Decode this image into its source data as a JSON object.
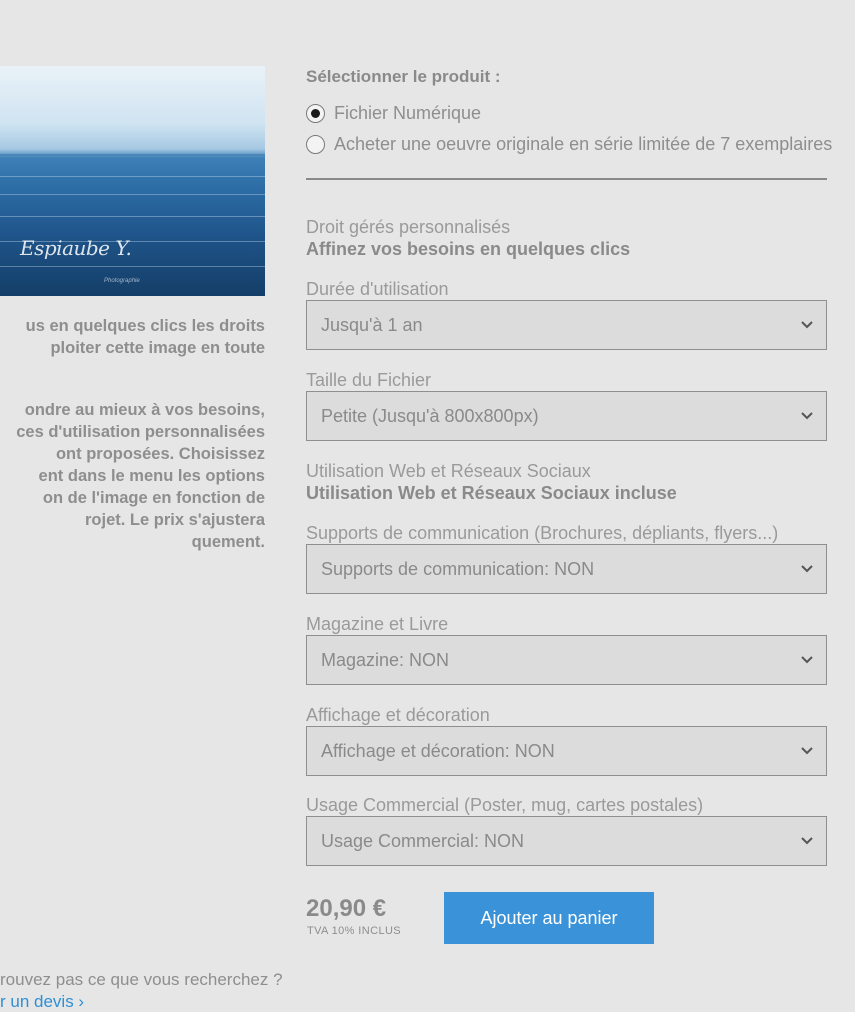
{
  "image": {
    "logo_text": "Espiaube Y.",
    "logo_subtext": "Photographie"
  },
  "description": {
    "para1": [
      "us en quelques clics les droits",
      "ploiter cette image en toute"
    ],
    "para2": [
      "ondre au mieux à vos besoins,",
      "ces d'utilisation personnalisées",
      "ont proposées. Choisissez",
      "ent dans le menu les options",
      "on de l'image en fonction de",
      "rojet. Le prix s'ajustera",
      "quement."
    ]
  },
  "product": {
    "title": "Sélectionner le produit :",
    "options": [
      {
        "label": "Fichier Numérique",
        "selected": true
      },
      {
        "label": "Acheter une oeuvre originale en série limitée de 7 exemplaires",
        "selected": false
      }
    ]
  },
  "rights": {
    "heading": "Droit gérés personnalisés",
    "subheading": "Affinez vos besoins en quelques clics",
    "duration": {
      "label": "Durée d'utilisation",
      "value": "Jusqu'à 1 an"
    },
    "file_size": {
      "label": "Taille du Fichier",
      "value": "Petite (Jusqu'à 800x800px)"
    },
    "web": {
      "label": "Utilisation Web et Réseaux Sociaux",
      "value": "Utilisation Web et Réseaux Sociaux incluse"
    },
    "communication": {
      "label": "Supports de communication (Brochures, dépliants, flyers...)",
      "value": "Supports de communication: NON"
    },
    "magazine": {
      "label": "Magazine et Livre",
      "value": "Magazine: NON"
    },
    "display": {
      "label": "Affichage et décoration",
      "value": "Affichage et décoration: NON"
    },
    "commercial": {
      "label": "Usage Commercial (Poster, mug, cartes postales)",
      "value": "Usage Commercial: NON"
    }
  },
  "cart": {
    "price": "20,90 €",
    "tax_note": "TVA 10% INCLUS",
    "add_label": "Ajouter au panier"
  },
  "footer": {
    "not_found": "rouvez pas ce que vous recherchez ?",
    "quote_link": "r un devis ›"
  },
  "colors": {
    "background": "#e6e6e6",
    "accent": "#3a93d9",
    "link": "#2f8fd6"
  }
}
